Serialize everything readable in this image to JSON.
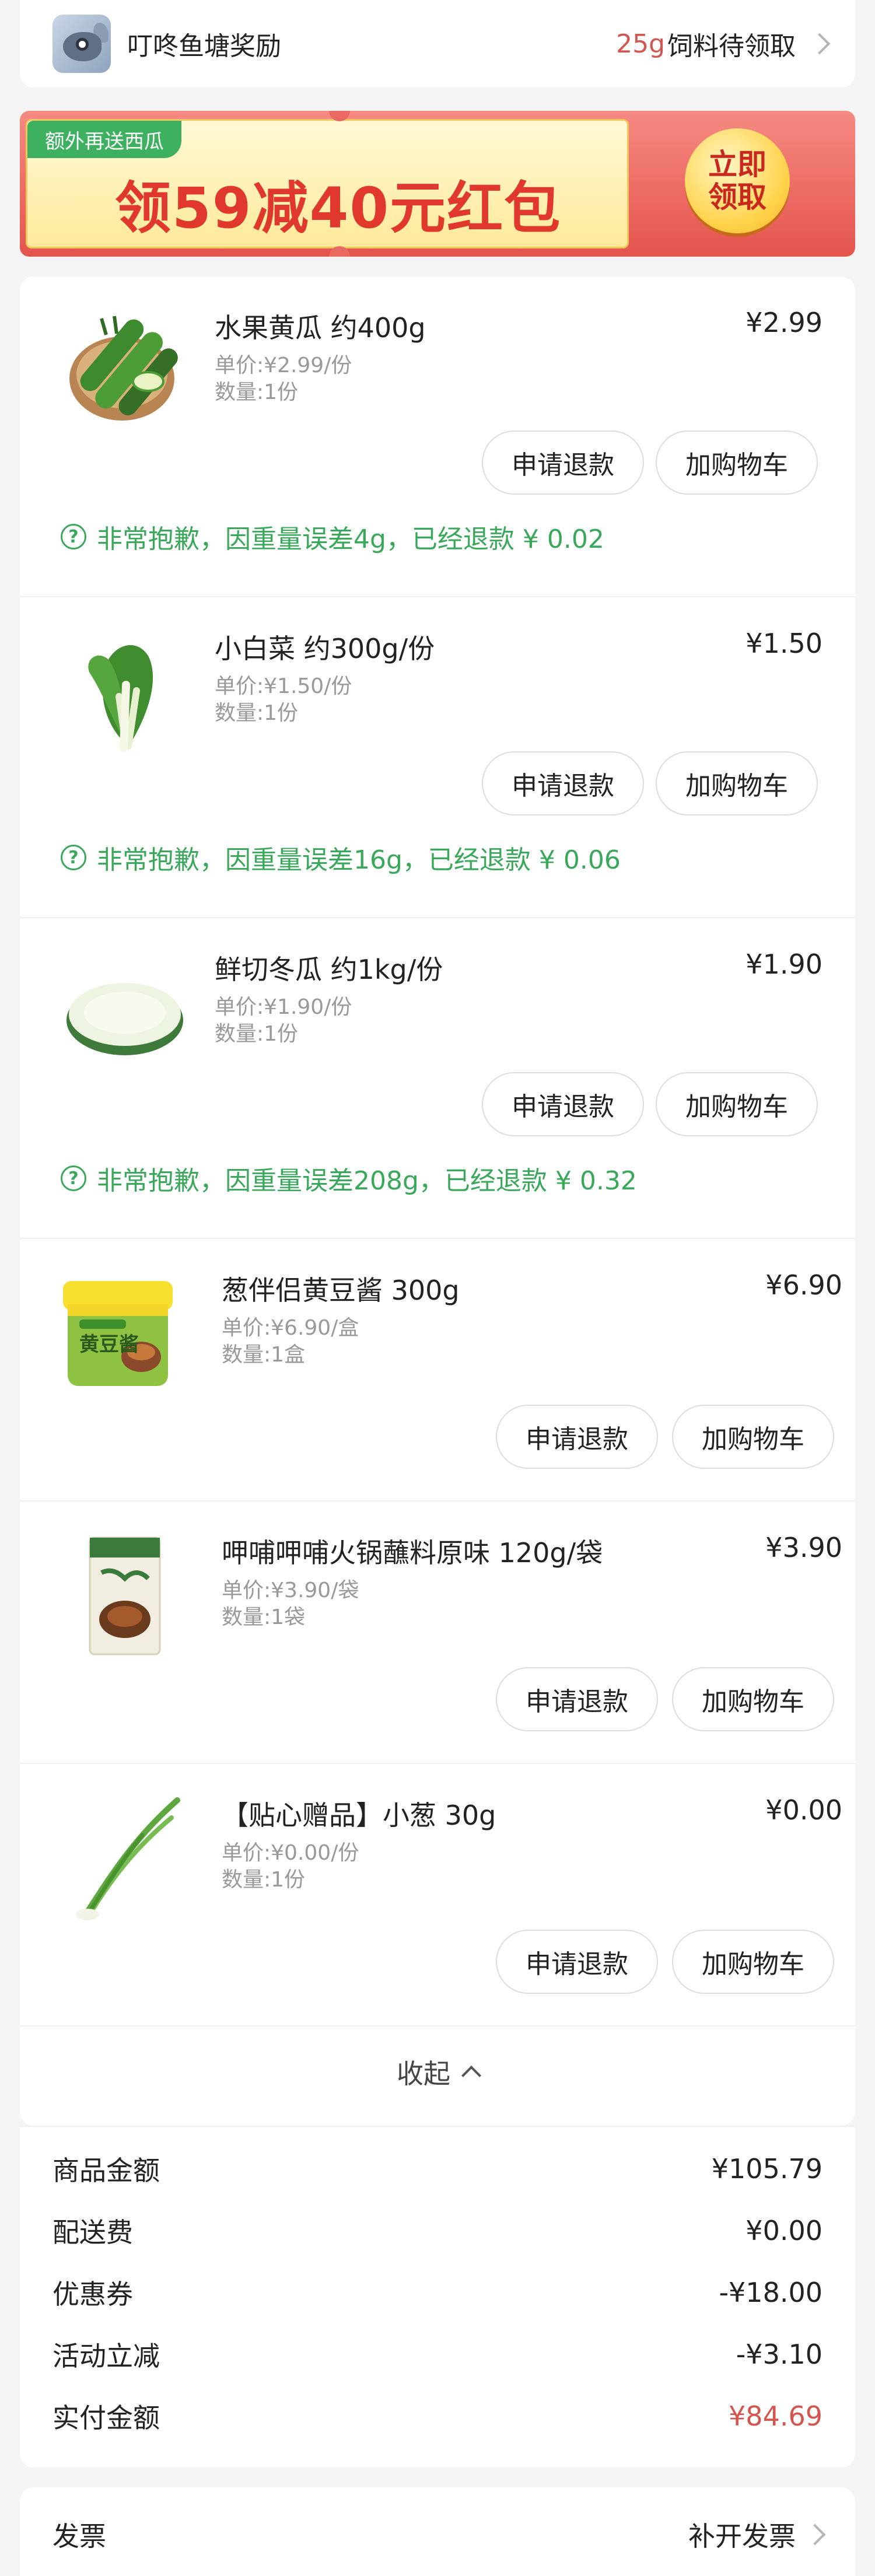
{
  "reward": {
    "title": "叮咚鱼塘奖励",
    "count": "25g",
    "pending": "饲料待领取"
  },
  "banner": {
    "tag": "额外再送西瓜",
    "headline": "领59减40元红包",
    "button": "立即领取"
  },
  "products": [
    {
      "name": "水果黄瓜 约400g",
      "price": "¥2.99",
      "unit": "单价:¥2.99/份",
      "qty": "数量:1份",
      "refund": "申请退款",
      "cart": "加购物车",
      "notice": "非常抱歉，因重量误差4g，已经退款 ¥ 0.02",
      "icon": "cucumber-icon"
    },
    {
      "name": "小白菜 约300g/份",
      "price": "¥1.50",
      "unit": "单价:¥1.50/份",
      "qty": "数量:1份",
      "refund": "申请退款",
      "cart": "加购物车",
      "notice": "非常抱歉，因重量误差16g，已经退款 ¥ 0.06",
      "icon": "bok-choy-icon"
    },
    {
      "name": "鲜切冬瓜 约1kg/份",
      "price": "¥1.90",
      "unit": "单价:¥1.90/份",
      "qty": "数量:1份",
      "refund": "申请退款",
      "cart": "加购物车",
      "notice": "非常抱歉，因重量误差208g，已经退款 ¥ 0.32",
      "icon": "winter-melon-icon"
    },
    {
      "name": "葱伴侣黄豆酱 300g",
      "price": "¥6.90",
      "unit": "单价:¥6.90/盒",
      "qty": "数量:1盒",
      "refund": "申请退款",
      "cart": "加购物车",
      "notice": "",
      "icon": "soybean-paste-icon",
      "package_label": "黄豆酱"
    },
    {
      "name": "呷哺呷哺火锅蘸料原味 120g/袋",
      "price": "¥3.90",
      "unit": "单价:¥3.90/袋",
      "qty": "数量:1袋",
      "refund": "申请退款",
      "cart": "加购物车",
      "notice": "",
      "icon": "hotpot-sauce-icon"
    },
    {
      "name": "【贴心赠品】小葱 30g",
      "price": "¥0.00",
      "unit": "单价:¥0.00/份",
      "qty": "数量:1份",
      "refund": "申请退款",
      "cart": "加购物车",
      "notice": "",
      "icon": "scallion-icon"
    }
  ],
  "collapse_label": "收起",
  "summary": {
    "goods_label": "商品金额",
    "goods_value": "¥105.79",
    "delivery_label": "配送费",
    "delivery_value": "¥0.00",
    "coupon_label": "优惠券",
    "coupon_value": "-¥18.00",
    "promo_label": "活动立减",
    "promo_value": "-¥3.10",
    "paid_label": "实付金额",
    "paid_value": "¥84.69"
  },
  "invoice": {
    "label": "发票",
    "action": "补开发票"
  },
  "colors": {
    "accent_red": "#d2564f",
    "notice_green": "#3aa85b"
  }
}
